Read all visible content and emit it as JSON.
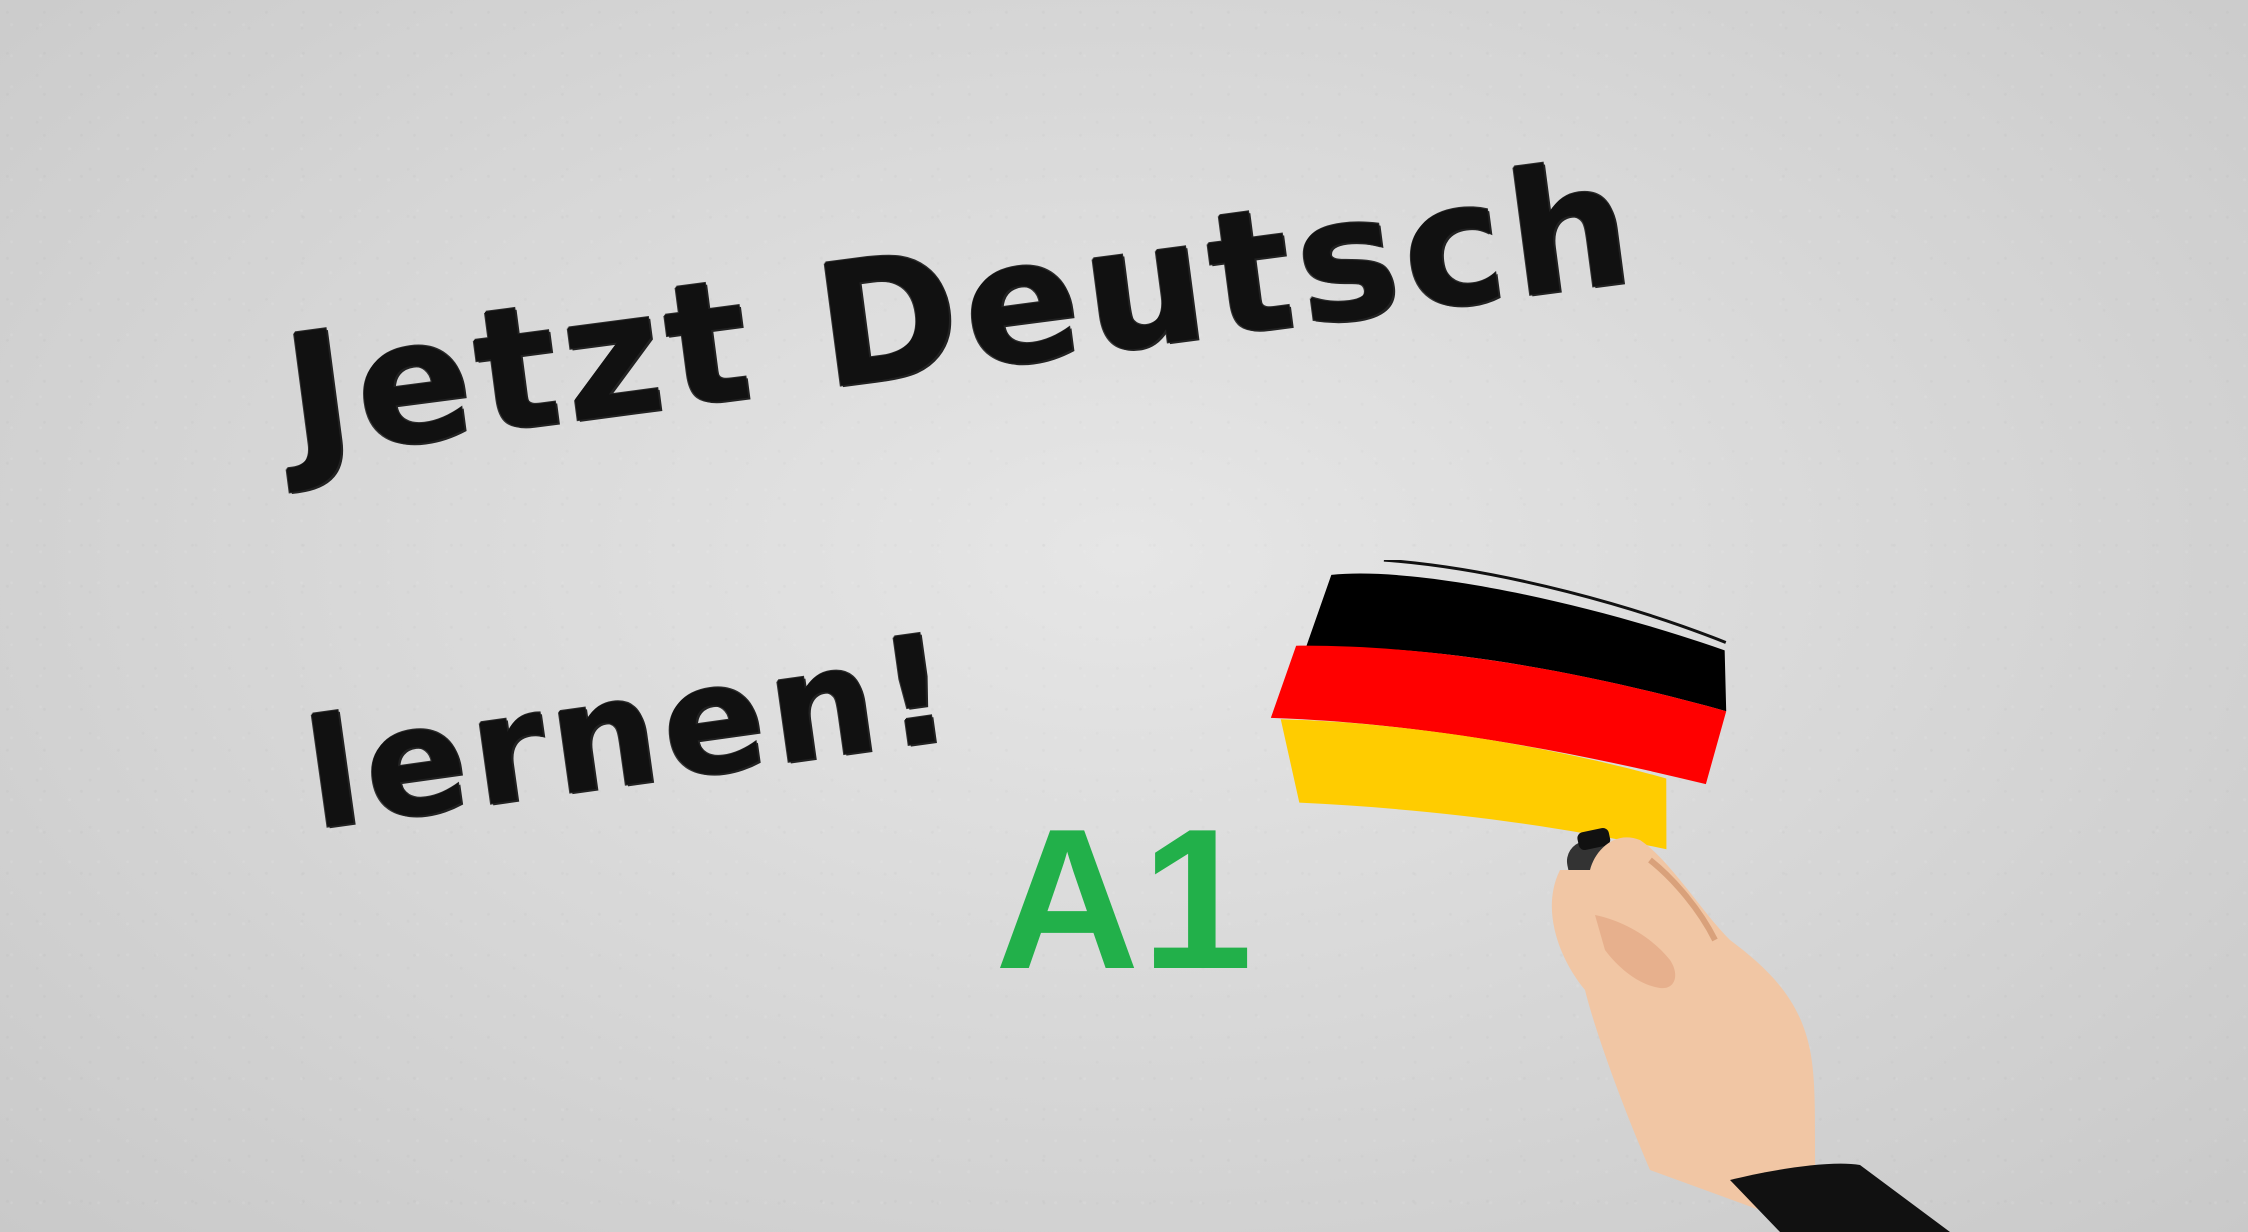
{
  "headline": {
    "line1": "Jetzt Deutsch",
    "line2": "lernen!"
  },
  "level": {
    "label": "A1",
    "color": "#22b04a"
  },
  "flag": {
    "name": "german-flag",
    "stripes": [
      "#000000",
      "#ff0000",
      "#ffcc00"
    ]
  },
  "icons": {
    "flag_icon": "german-flag-icon",
    "hand_icon": "hand-with-marker-icon"
  }
}
